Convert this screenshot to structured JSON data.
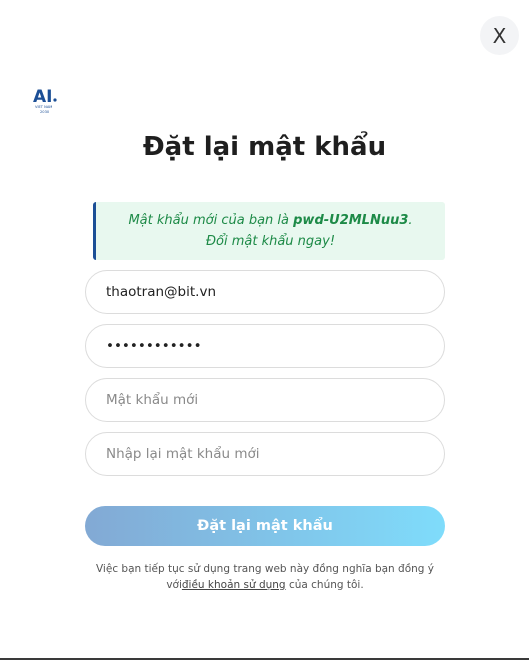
{
  "close": {
    "label": "X"
  },
  "logo": {
    "text": "AI",
    "subtext": "VIET NAM",
    "year": "2030",
    "color": "#1c4f96"
  },
  "page": {
    "title": "Đặt lại mật khẩu"
  },
  "notice": {
    "line1_prefix": "Mật khẩu mới của bạn là ",
    "line1_password": "pwd-U2MLNuu3",
    "line1_suffix": ".",
    "line2": "Đổi mật khẩu ngay!"
  },
  "form": {
    "email": {
      "value": "thaotran@bit.vn"
    },
    "current_password": {
      "value": "pwd-U2MLNuu3"
    },
    "new_password": {
      "value": "",
      "placeholder": "Mật khẩu mới"
    },
    "confirm_password": {
      "value": "",
      "placeholder": "Nhập lại mật khẩu mới"
    },
    "submit_label": "Đặt lại mật khẩu"
  },
  "terms": {
    "line1": "Việc bạn tiếp tục sử dụng trang web này đồng nghĩa bạn đồng ý",
    "prefix": "với",
    "link": "điều khoản sử dụng",
    "suffix": " của chúng tôi."
  },
  "colors": {
    "notice_bg": "#e8f8ef",
    "notice_text": "#1d8a47",
    "notice_border": "#1c4f96",
    "button_gradient_start": "#82a9d4",
    "button_gradient_end": "#7fdcfb"
  }
}
